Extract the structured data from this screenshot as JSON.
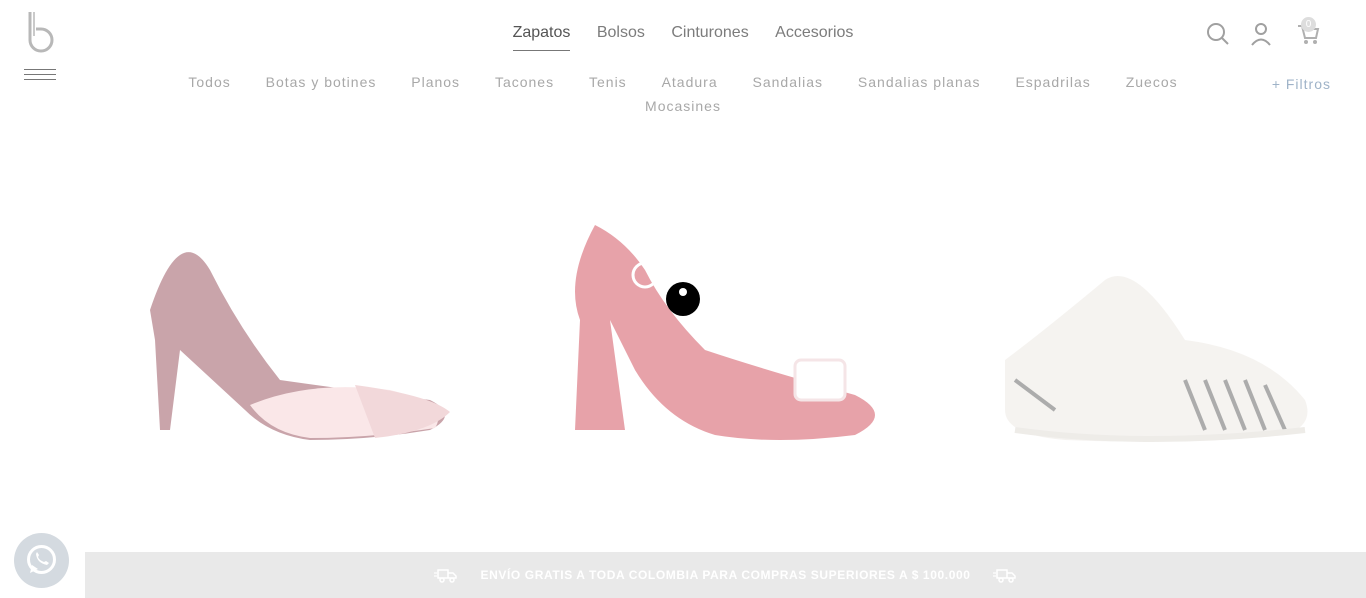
{
  "header": {
    "logo_icon": "b-logo-icon",
    "menu_icon": "hamburger-menu-icon",
    "main_nav": [
      {
        "label": "Zapatos",
        "active": true
      },
      {
        "label": "Bolsos",
        "active": false
      },
      {
        "label": "Cinturones",
        "active": false
      },
      {
        "label": "Accesorios",
        "active": false
      }
    ],
    "icons": [
      "search-icon",
      "user-icon",
      "cart-icon"
    ],
    "cart_count": "0"
  },
  "sub_nav": [
    "Todos",
    "Botas y botines",
    "Planos",
    "Tacones",
    "Tenis",
    "Atadura",
    "Sandalias",
    "Sandalias planas",
    "Espadrilas",
    "Zuecos",
    "Mocasines"
  ],
  "filters_label": "+ Filtros",
  "products": [
    {
      "name": "pointed-heel-pump",
      "colors": {
        "main": "#7a1e2e",
        "accent": "#f3c5c8"
      }
    },
    {
      "name": "red-slingback-heel",
      "colors": {
        "main": "#c4182a",
        "accent": "#ffffff"
      }
    },
    {
      "name": "striped-espadrille",
      "colors": {
        "main": "#e8e2dc",
        "accent": "#333333"
      }
    }
  ],
  "loader": "loading-spinner-icon",
  "whatsapp_icon": "whatsapp-icon",
  "banner": {
    "text": "ENVÍO GRATIS A TODA COLOMBIA PARA COMPRAS SUPERIORES A $ 100.000",
    "icon": "delivery-truck-icon",
    "background": "#e9e9e9"
  }
}
